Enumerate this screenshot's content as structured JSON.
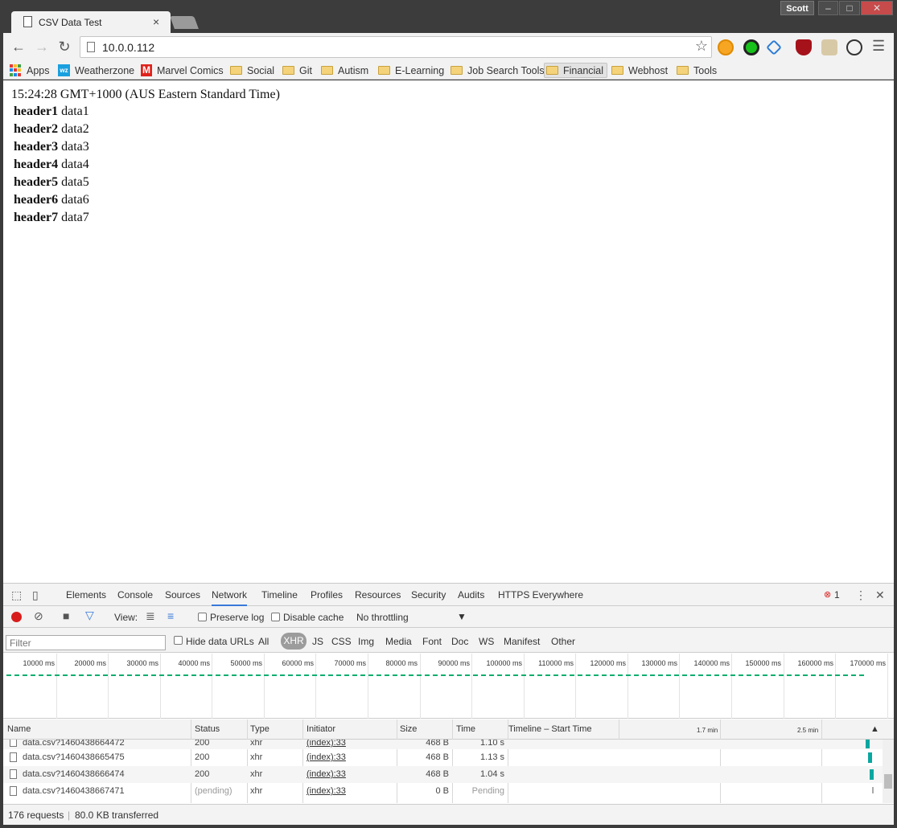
{
  "window": {
    "tab_title": "CSV Data Test",
    "profile_name": "Scott",
    "close_tab_glyph": "×"
  },
  "toolbar": {
    "url": "10.0.0.112"
  },
  "bookmarks": [
    {
      "label": "Apps",
      "icon": "apps-grid-icon"
    },
    {
      "label": "Weatherzone",
      "icon": "weatherzone-icon"
    },
    {
      "label": "Marvel Comics",
      "icon": "marvel-icon"
    },
    {
      "label": "Social",
      "icon": "folder-icon"
    },
    {
      "label": "Git",
      "icon": "folder-icon"
    },
    {
      "label": "Autism",
      "icon": "folder-icon"
    },
    {
      "label": "E-Learning",
      "icon": "folder-icon"
    },
    {
      "label": "Job Search Tools",
      "icon": "folder-icon"
    },
    {
      "label": "Financial",
      "icon": "folder-icon"
    },
    {
      "label": "Webhost",
      "icon": "folder-icon"
    },
    {
      "label": "Tools",
      "icon": "folder-icon"
    }
  ],
  "page": {
    "timestamp": "15:24:28 GMT+1000 (AUS Eastern Standard Time)",
    "rows": [
      {
        "header": "header1",
        "data": "data1"
      },
      {
        "header": "header2",
        "data": "data2"
      },
      {
        "header": "header3",
        "data": "data3"
      },
      {
        "header": "header4",
        "data": "data4"
      },
      {
        "header": "header5",
        "data": "data5"
      },
      {
        "header": "header6",
        "data": "data6"
      },
      {
        "header": "header7",
        "data": "data7"
      }
    ]
  },
  "devtools": {
    "tabs": [
      "Elements",
      "Console",
      "Sources",
      "Network",
      "Timeline",
      "Profiles",
      "Resources",
      "Security",
      "Audits",
      "HTTPS Everywhere"
    ],
    "active_tab": "Network",
    "error_count": "1",
    "view_label": "View:",
    "preserve_log": "Preserve log",
    "disable_cache": "Disable cache",
    "throttling": "No throttling",
    "filter_placeholder": "Filter",
    "hide_data_urls": "Hide data URLs",
    "type_filters": [
      "All",
      "XHR",
      "JS",
      "CSS",
      "Img",
      "Media",
      "Font",
      "Doc",
      "WS",
      "Manifest",
      "Other"
    ],
    "active_type_filter": "XHR",
    "overview_ticks": [
      "10000 ms",
      "20000 ms",
      "30000 ms",
      "40000 ms",
      "50000 ms",
      "60000 ms",
      "70000 ms",
      "80000 ms",
      "90000 ms",
      "100000 ms",
      "110000 ms",
      "120000 ms",
      "130000 ms",
      "140000 ms",
      "150000 ms",
      "160000 ms",
      "170000 ms"
    ],
    "columns": {
      "name": "Name",
      "status": "Status",
      "type": "Type",
      "initiator": "Initiator",
      "size": "Size",
      "time": "Time",
      "timeline": "Timeline – Start Time",
      "tick1": "1.7 min",
      "tick2": "2.5 min"
    },
    "requests": [
      {
        "name": "data.csv?1460438664472",
        "status": "200",
        "type": "xhr",
        "initiator": "(index):33",
        "size": "468 B",
        "time": "1.10 s"
      },
      {
        "name": "data.csv?1460438665475",
        "status": "200",
        "type": "xhr",
        "initiator": "(index):33",
        "size": "468 B",
        "time": "1.13 s"
      },
      {
        "name": "data.csv?1460438666474",
        "status": "200",
        "type": "xhr",
        "initiator": "(index):33",
        "size": "468 B",
        "time": "1.04 s"
      },
      {
        "name": "data.csv?1460438667471",
        "status": "(pending)",
        "type": "xhr",
        "initiator": "(index):33",
        "size": "0 B",
        "time": "Pending"
      }
    ],
    "status_bar": {
      "requests": "176 requests",
      "separator": "|",
      "transferred": "80.0 KB transferred"
    }
  },
  "colors": {
    "record": "#d81d1d",
    "timeline_bar": "#0aa7a0",
    "overview_line": "#0fae6f",
    "active_tab_underline": "#3879d9"
  }
}
